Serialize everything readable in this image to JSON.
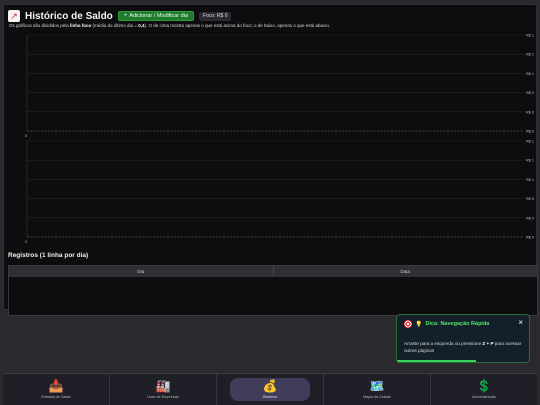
{
  "header": {
    "icon": "chart-up-icon",
    "title": "Histórico de Saldo",
    "add_button": "Adicionar / Modificar dia",
    "focus_badge": "Foco: R$ 0",
    "subtitle_pre": "Os gráficos são divididos pela ",
    "subtitle_bold": "linha foco",
    "subtitle_mid": " (média do último dia = ",
    "subtitle_value": "0,4",
    "subtitle_post": "). O de cima mostra apenas o que está acima do foco; o de baixo, apenas o que está abaixo."
  },
  "chart_data": [
    {
      "type": "line",
      "title": "",
      "series": [],
      "x_tick_labels": [
        "0"
      ],
      "y_tick_labels": [
        "R$ 1",
        "R$ 1",
        "R$ 1",
        "R$ 0",
        "R$ 0",
        "R$ 0"
      ],
      "grid": true
    },
    {
      "type": "line",
      "title": "",
      "series": [],
      "x_tick_labels": [
        "0"
      ],
      "y_tick_labels": [
        "R$ 1",
        "R$ 1",
        "R$ 1",
        "R$ 0",
        "R$ 0",
        "R$ 0"
      ],
      "grid": true
    }
  ],
  "registros": {
    "title": "Registros (1 linha por dia)",
    "columns": [
      "Dia",
      "Data"
    ],
    "rows": []
  },
  "toast": {
    "title": "Dica: Navegação Rápida",
    "body_pre": "Arraste para a esquerda ou pressione ",
    "shortcut": "Z + P",
    "body_post": " para acessar outras páginas",
    "close": "×",
    "progress": 0.6
  },
  "nav": [
    {
      "icon": "inbox-tray-icon",
      "emoji": "📥",
      "label": "Entrada de Saldo",
      "active": false
    },
    {
      "icon": "factory-icon",
      "emoji": "🏭",
      "label": "Lista de Empresas",
      "active": false
    },
    {
      "icon": "money-bag-icon",
      "emoji": "💰",
      "label": "Histórico",
      "active": true
    },
    {
      "icon": "map-icon",
      "emoji": "🗺️",
      "label": "Mapa da Cidade",
      "active": false
    },
    {
      "icon": "dollar-icon",
      "emoji": "💲",
      "label": "Administração",
      "active": false
    }
  ],
  "colors": {
    "accent_green": "#1f7a2d",
    "toast_title": "#56e06b",
    "panel_bg": "#0d0d0f"
  }
}
